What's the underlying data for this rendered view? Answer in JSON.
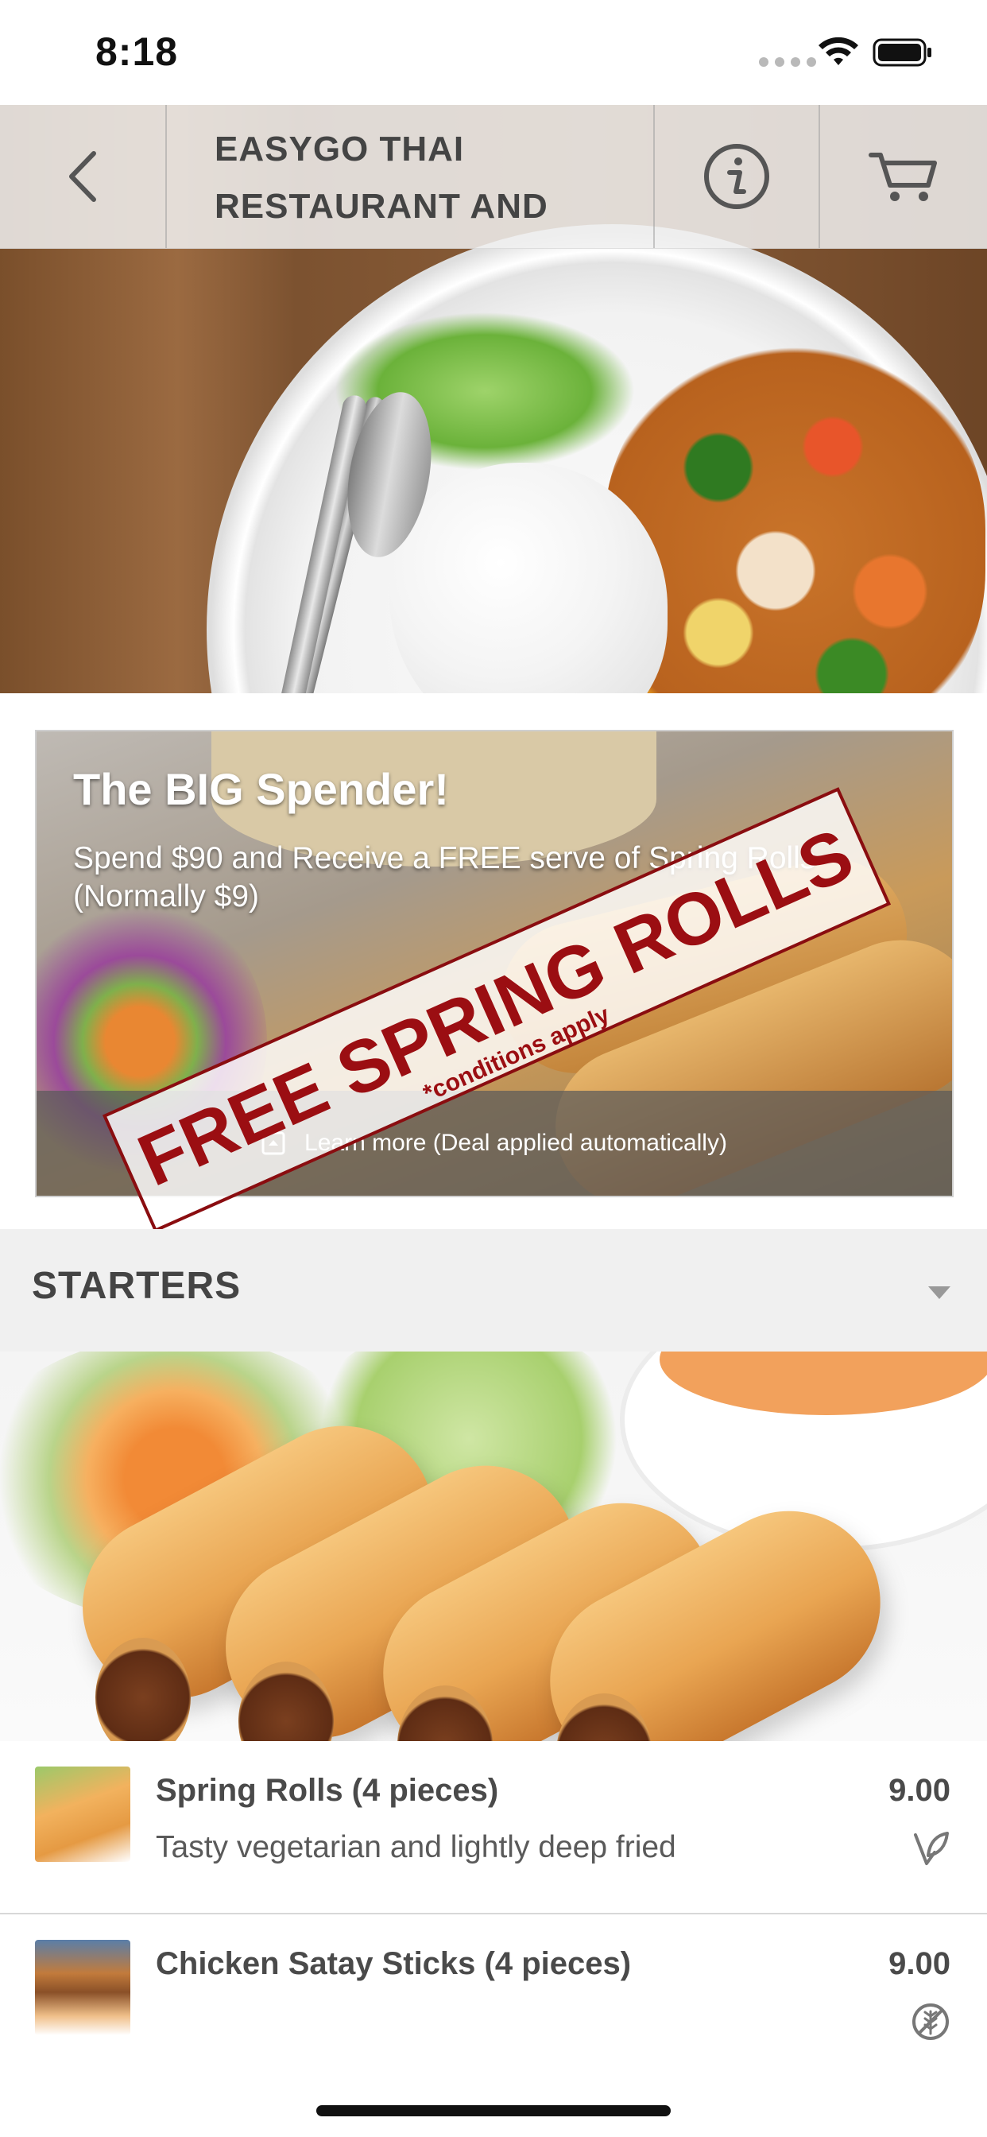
{
  "status_bar": {
    "time": "8:18"
  },
  "nav": {
    "title_line1": "EASYGO THAI",
    "title_line2": "RESTAURANT AND",
    "back_icon": "chevron-left-icon",
    "info_icon": "info-icon",
    "cart_icon": "cart-icon"
  },
  "promo": {
    "title": "The BIG Spender!",
    "description": "Spend $90 and Receive a FREE serve of Spring Rolls (Normally $9)",
    "stamp_text": "FREE SPRING ROLLS",
    "stamp_subtext": "*conditions apply",
    "footer_link": "Learn more (Deal applied automatically)"
  },
  "section": {
    "title": "STARTERS"
  },
  "items": [
    {
      "name": "Spring Rolls (4 pieces)",
      "description": "Tasty vegetarian and lightly deep fried",
      "price": "9.00",
      "badge_icon": "vegetarian-leaf-icon"
    },
    {
      "name": "Chicken Satay Sticks (4 pieces)",
      "description": "",
      "price": "9.00",
      "badge_icon": "gluten-free-icon"
    }
  ],
  "colors": {
    "stamp_red": "#9b0e12",
    "nav_bg": "#f0f0f0",
    "text": "#444444"
  }
}
